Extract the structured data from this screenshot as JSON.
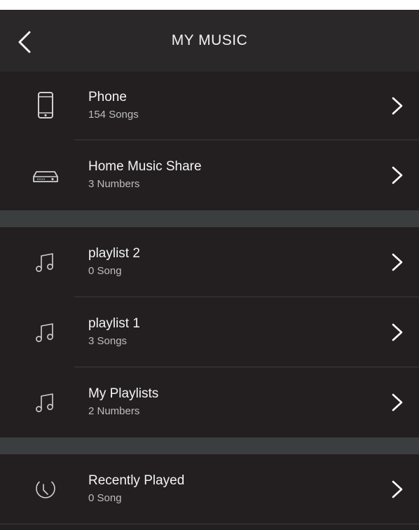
{
  "header": {
    "title": "MY MUSIC"
  },
  "sources": [
    {
      "name": "Phone",
      "sub": "154  Songs",
      "icon": "phone-icon"
    },
    {
      "name": "Home Music Share",
      "sub": "3 Numbers",
      "icon": "media-server-icon"
    }
  ],
  "playlists": [
    {
      "name": "playlist 2",
      "sub": "0  Song",
      "icon": "music-note-icon"
    },
    {
      "name": "playlist 1",
      "sub": "3  Songs",
      "icon": "music-note-icon"
    },
    {
      "name": "My Playlists",
      "sub": "2 Numbers",
      "icon": "music-note-icon"
    }
  ],
  "history": [
    {
      "name": "Recently Played",
      "sub": "0  Song",
      "icon": "clock-icon"
    }
  ],
  "colors": {
    "background": "#231f20",
    "header": "#2b2829",
    "section_gap": "#3b3e3e",
    "text_primary": "#f4f4f4",
    "text_secondary": "#bdbdbd"
  }
}
